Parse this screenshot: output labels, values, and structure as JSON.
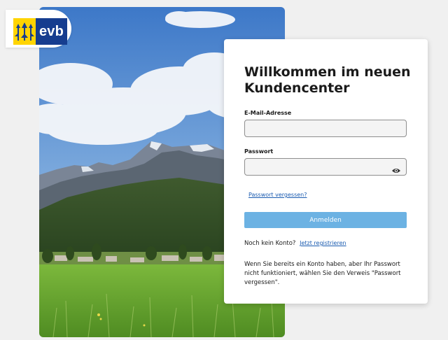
{
  "brand": {
    "logo_text": "evb",
    "logo_icon": "tulip-logo-icon",
    "colors": {
      "blue": "#163d8f",
      "yellow": "#ffd400"
    }
  },
  "hero": {
    "image": "mountain-landscape-photo"
  },
  "login": {
    "title": "Willkommen im neuen Kundencenter",
    "email_label": "E-Mail-Adresse",
    "email_value": "",
    "email_placeholder": "",
    "password_label": "Passwort",
    "password_value": "",
    "password_placeholder": "",
    "show_password_icon": "eye-icon",
    "forgot_link": "Passwort vergessen?",
    "submit_label": "Anmelden",
    "no_account_text": "Noch kein Konto?",
    "register_link": "Jetzt registrieren",
    "hint_text": "Wenn Sie bereits ein Konto haben, aber Ihr Passwort nicht funktioniert, wählen Sie den Verweis \"Passwort vergessen\"."
  },
  "colors": {
    "accent_button": "#6cb2e3",
    "link": "#1a5bb0",
    "page_background": "#f0f0f0"
  }
}
